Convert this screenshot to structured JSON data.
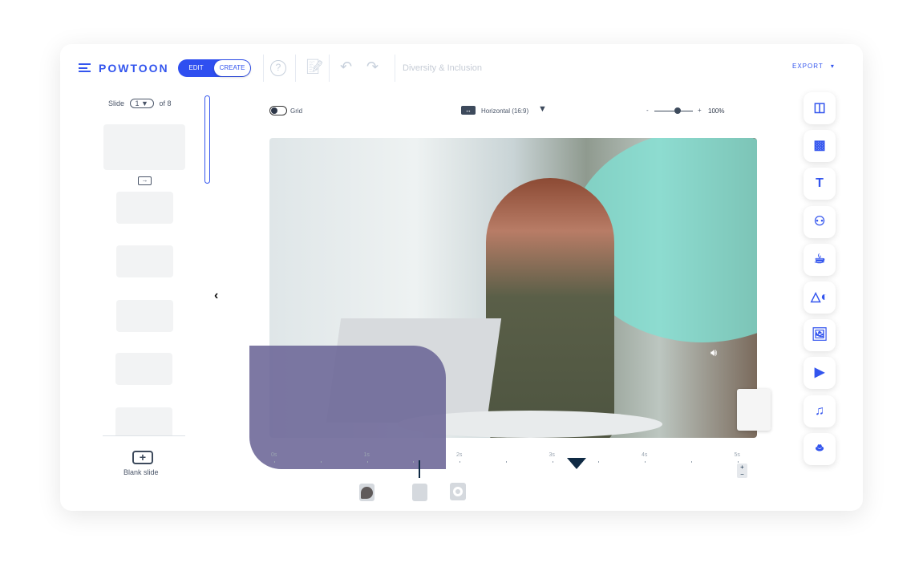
{
  "header": {
    "logo": "POWTOON",
    "edit": "EDIT",
    "create": "CREATE",
    "project_title": "Diversity &  Inclusion",
    "export": "EXPORT"
  },
  "slides": {
    "label": "Slide",
    "current": "1",
    "of": "of",
    "total": "8",
    "blank_slide": "Blank slide"
  },
  "canvas_toolbar": {
    "grid": "Grid",
    "orientation": "Horizontal (16:9)",
    "zoom_minus": "-",
    "zoom_plus": "+",
    "zoom": "100%",
    "zoom_level": 0.6
  },
  "timeline": {
    "ticks": [
      "0s",
      "1s",
      "2s",
      "3s",
      "4s",
      "5s"
    ]
  },
  "tools": [
    "layout-icon",
    "background-icon",
    "text-icon",
    "characters-icon",
    "props-icon",
    "shapes-icon",
    "images-icon",
    "video-icon",
    "music-icon",
    "magic-icon"
  ],
  "colors": {
    "accent": "#3355ee",
    "teal": "#7de3d5",
    "purple": "#6b6596",
    "marker": "#0f2a44"
  }
}
